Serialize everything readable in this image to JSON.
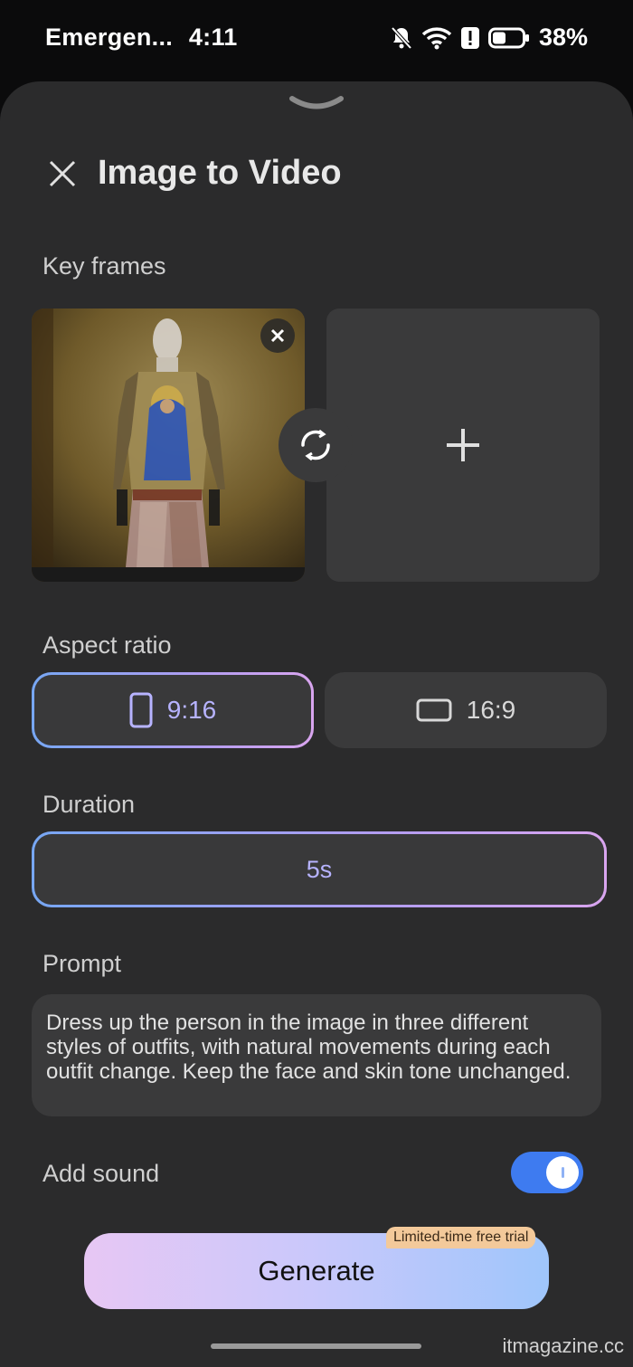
{
  "status_bar": {
    "carrier": "Emergen...",
    "time": "4:11",
    "battery": "38%",
    "icons": [
      "bell-muted-icon",
      "wifi-icon",
      "alert-icon",
      "battery-icon"
    ]
  },
  "header": {
    "title": "Image to Video"
  },
  "key_frames": {
    "label": "Key frames"
  },
  "aspect_ratio": {
    "label": "Aspect ratio",
    "options": [
      {
        "label": "9:16",
        "selected": true
      },
      {
        "label": "16:9",
        "selected": false
      }
    ]
  },
  "duration": {
    "label": "Duration",
    "value": "5s"
  },
  "prompt": {
    "label": "Prompt",
    "text": "Dress up the person in the image in three different styles of outfits, with natural movements during each outfit change. Keep the face and skin tone unchanged."
  },
  "sound": {
    "label": "Add sound",
    "enabled": true
  },
  "generate": {
    "label": "Generate",
    "badge": "Limited-time free trial"
  },
  "watermark": "itmagazine.cc",
  "colors": {
    "accent_blue": "#3e7bf0",
    "selection_gradient": [
      "#77a7f3",
      "#d9a5ef"
    ],
    "badge": "#f3c99a"
  }
}
